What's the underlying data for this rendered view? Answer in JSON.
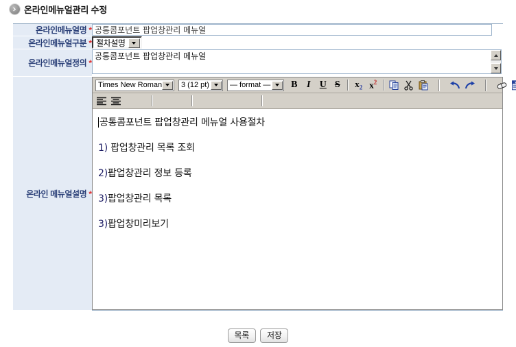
{
  "header": {
    "icon": "chevron-right-circle-icon",
    "title": "온라인메뉴얼관리 수정"
  },
  "form": {
    "required_mark": "*",
    "rows": [
      {
        "label": "온라인메뉴얼명",
        "required": true,
        "control": "text-input",
        "value": "공통콤포넌트 팝업창관리 메뉴얼"
      },
      {
        "label": "온라인메뉴얼구분",
        "required": true,
        "control": "select",
        "value": "절차설명"
      },
      {
        "label": "온라인메뉴얼정의",
        "required": true,
        "control": "textarea",
        "value": "공통콤포넌트 팝업창관리 메뉴얼"
      },
      {
        "label": "온라인 메뉴얼설명",
        "required": true,
        "control": "rich-text-editor"
      }
    ]
  },
  "editor": {
    "toolbar": {
      "font_family": "Times New Roman",
      "font_size": "3 (12 pt)",
      "format": "— format —",
      "buttons": [
        {
          "name": "bold-icon",
          "glyph": "B"
        },
        {
          "name": "italic-icon",
          "glyph": "I"
        },
        {
          "name": "underline-icon",
          "glyph": "U"
        },
        {
          "name": "strikethrough-icon",
          "glyph": "S"
        },
        {
          "name": "subscript-icon",
          "glyph": "x2"
        },
        {
          "name": "superscript-icon",
          "glyph": "x2"
        },
        {
          "name": "copy-icon",
          "glyph": ""
        },
        {
          "name": "cut-icon",
          "glyph": ""
        },
        {
          "name": "paste-icon",
          "glyph": ""
        },
        {
          "name": "undo-icon",
          "glyph": ""
        },
        {
          "name": "redo-icon",
          "glyph": ""
        },
        {
          "name": "eraser-icon",
          "glyph": ""
        },
        {
          "name": "paste-from-word-icon",
          "glyph": ""
        }
      ],
      "row2_buttons": [
        {
          "name": "align-left-icon"
        },
        {
          "name": "align-center-icon"
        }
      ]
    },
    "content": {
      "lines": [
        {
          "num": "",
          "text": "공통콤포넌트 팝업창관리 메뉴얼 사용절차",
          "caret": true
        },
        {
          "num": "1)",
          "text": " 팝업창관리 목록 조회",
          "caret": false
        },
        {
          "num": "2)",
          "text": "팝업창관리 정보 등록",
          "caret": false
        },
        {
          "num": "3)",
          "text": "팝업창관리 목록",
          "caret": false
        },
        {
          "num": "3)",
          "text": "팝업창미리보기",
          "caret": false
        }
      ]
    }
  },
  "buttons": {
    "list_label": "목록",
    "save_label": "저장"
  },
  "colors": {
    "label_bg": "#e4ebf5",
    "label_text": "#2a3f77",
    "required": "#e03030",
    "table_border": "#9ab0c6",
    "toolbar_bg": "#d4d0c8"
  }
}
